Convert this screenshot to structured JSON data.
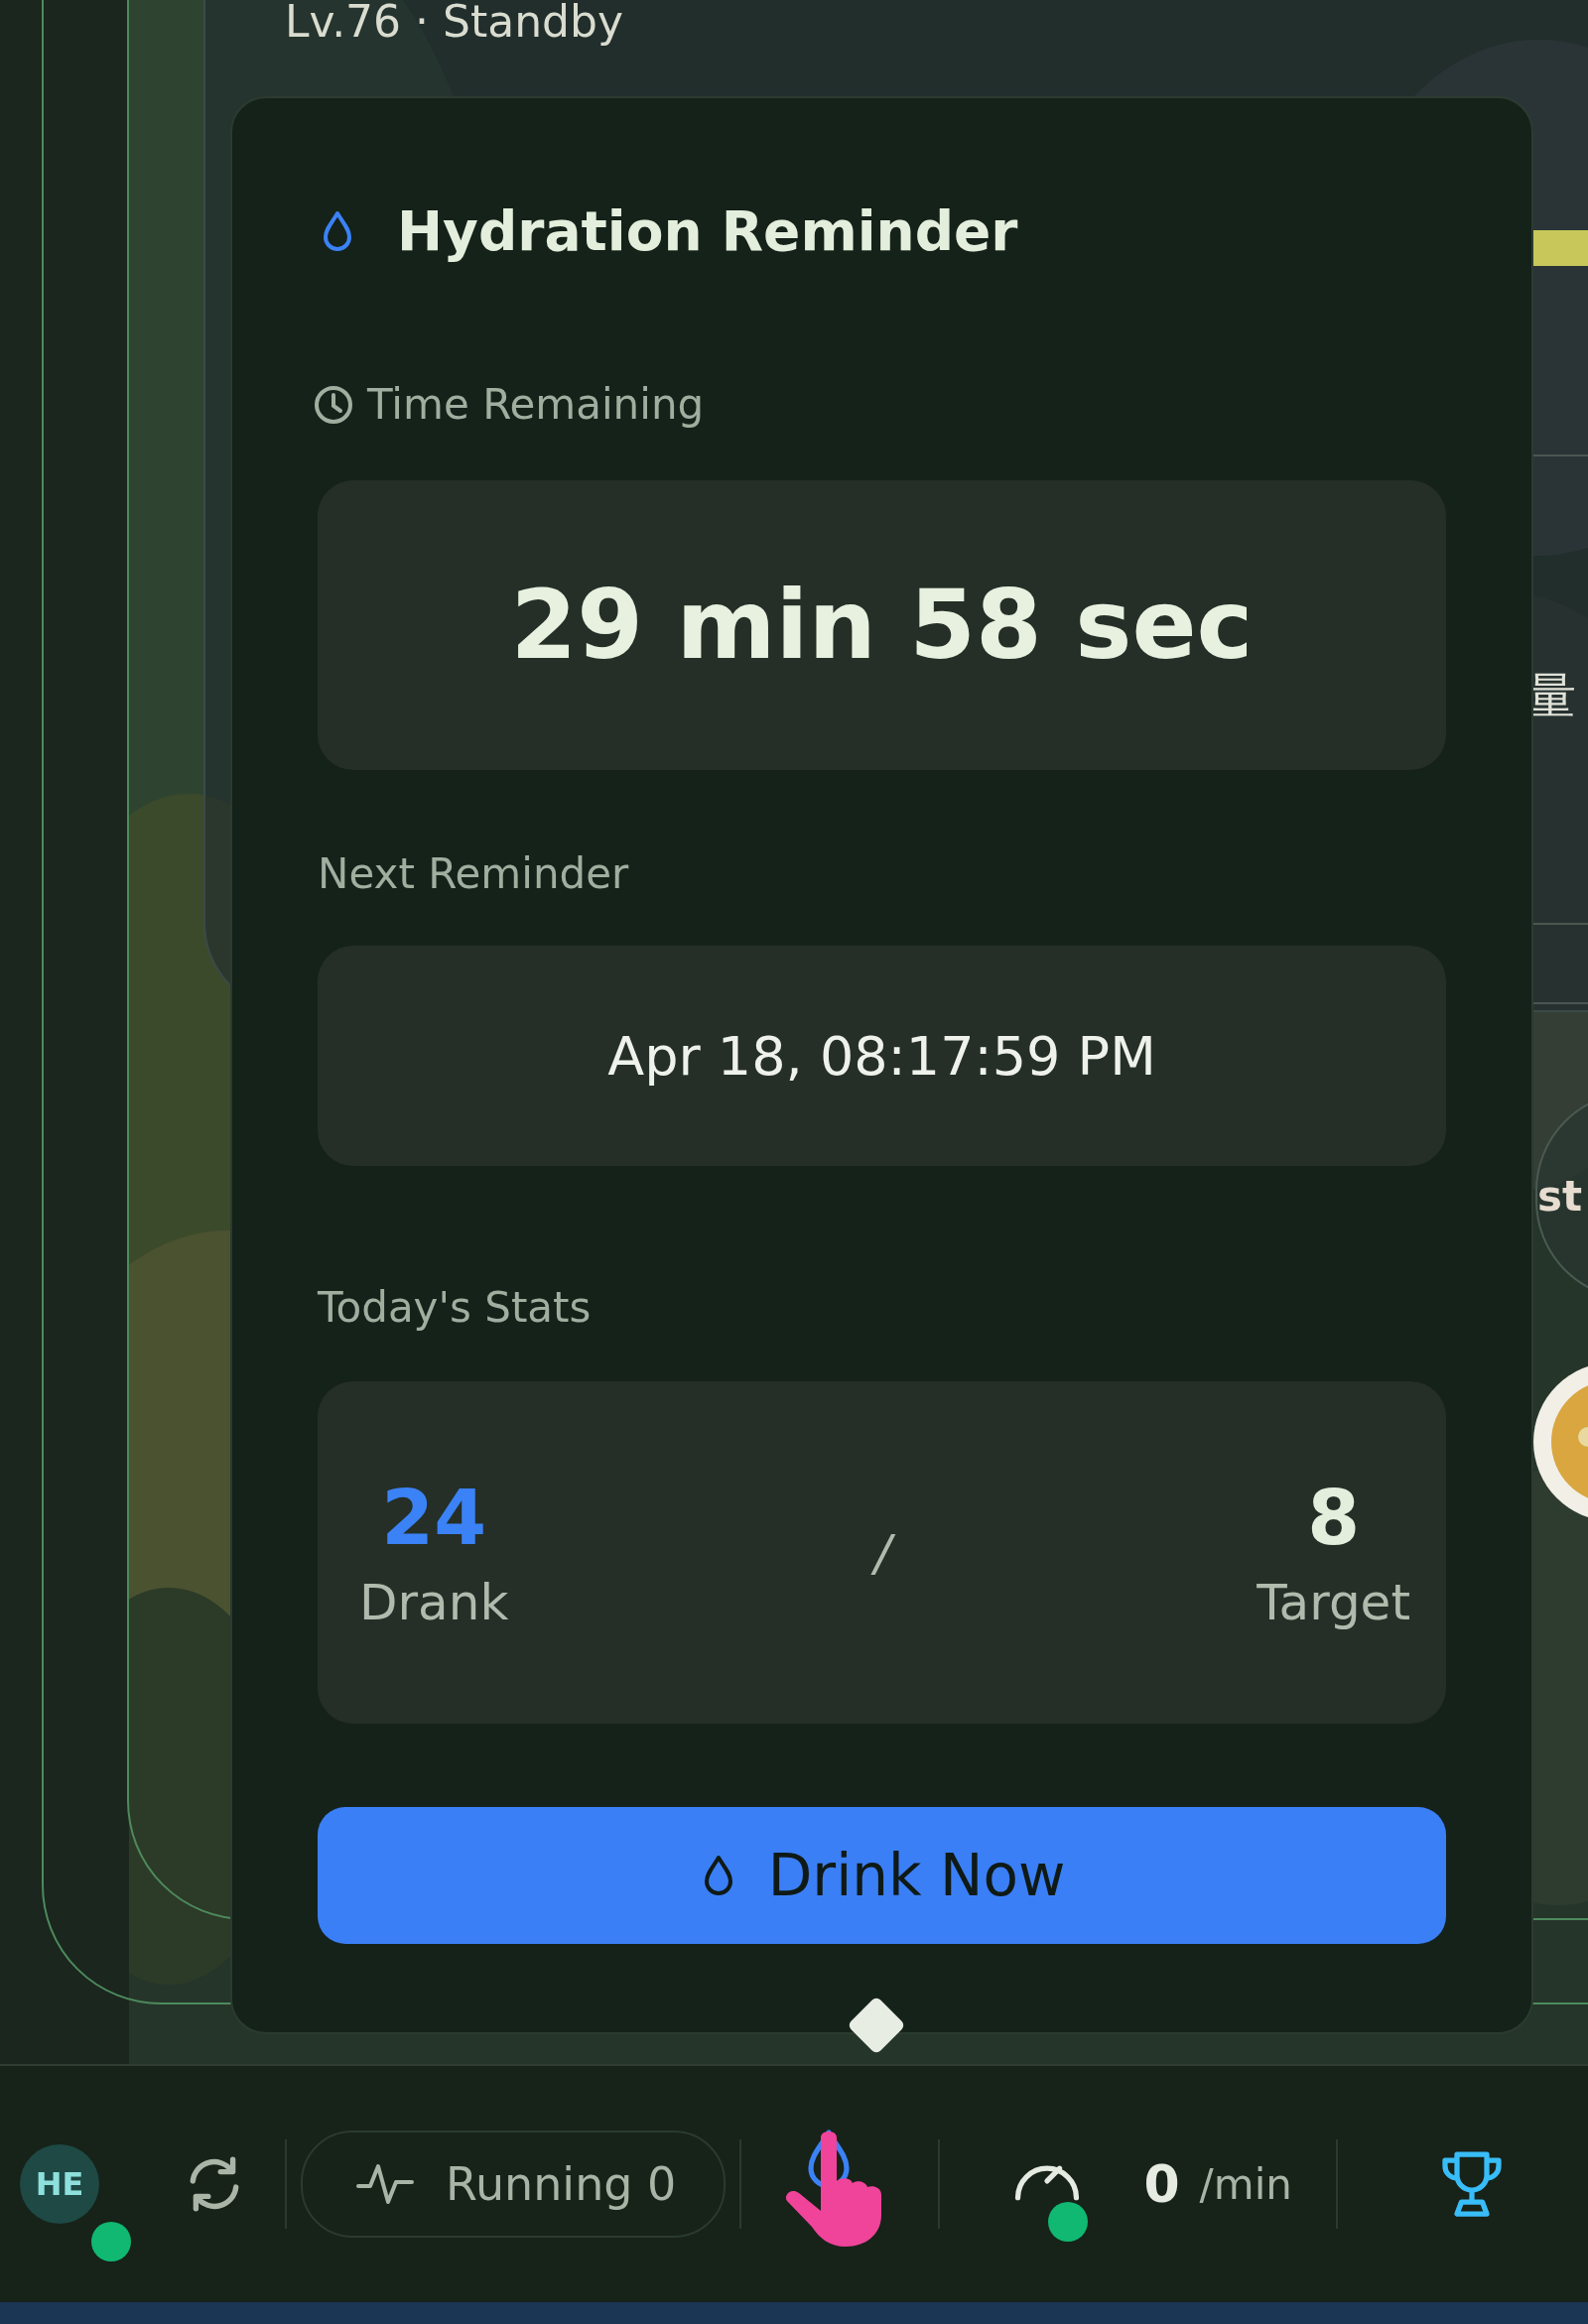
{
  "status_text": "Lv.76 · Standby",
  "background_texts": [
    {
      "kind": "label",
      "text": "量"
    },
    {
      "kind": "chip",
      "text": "st"
    }
  ],
  "popover": {
    "title": "Hydration Reminder",
    "time_label": "Time Remaining",
    "time_value": "29 min 58 sec",
    "next_label": "Next Reminder",
    "next_value": "Apr 18, 08:17:59 PM",
    "stats_label": "Today's Stats",
    "drank": {
      "value": "24",
      "label": "Drank"
    },
    "separator": "/",
    "target": {
      "value": "8",
      "label": "Target"
    },
    "button": "Drink Now"
  },
  "bottom_bar": {
    "avatar": "HE",
    "online": true,
    "running": "Running 0",
    "rate_value": "0",
    "rate_unit": "/min",
    "rate_online": true
  }
}
